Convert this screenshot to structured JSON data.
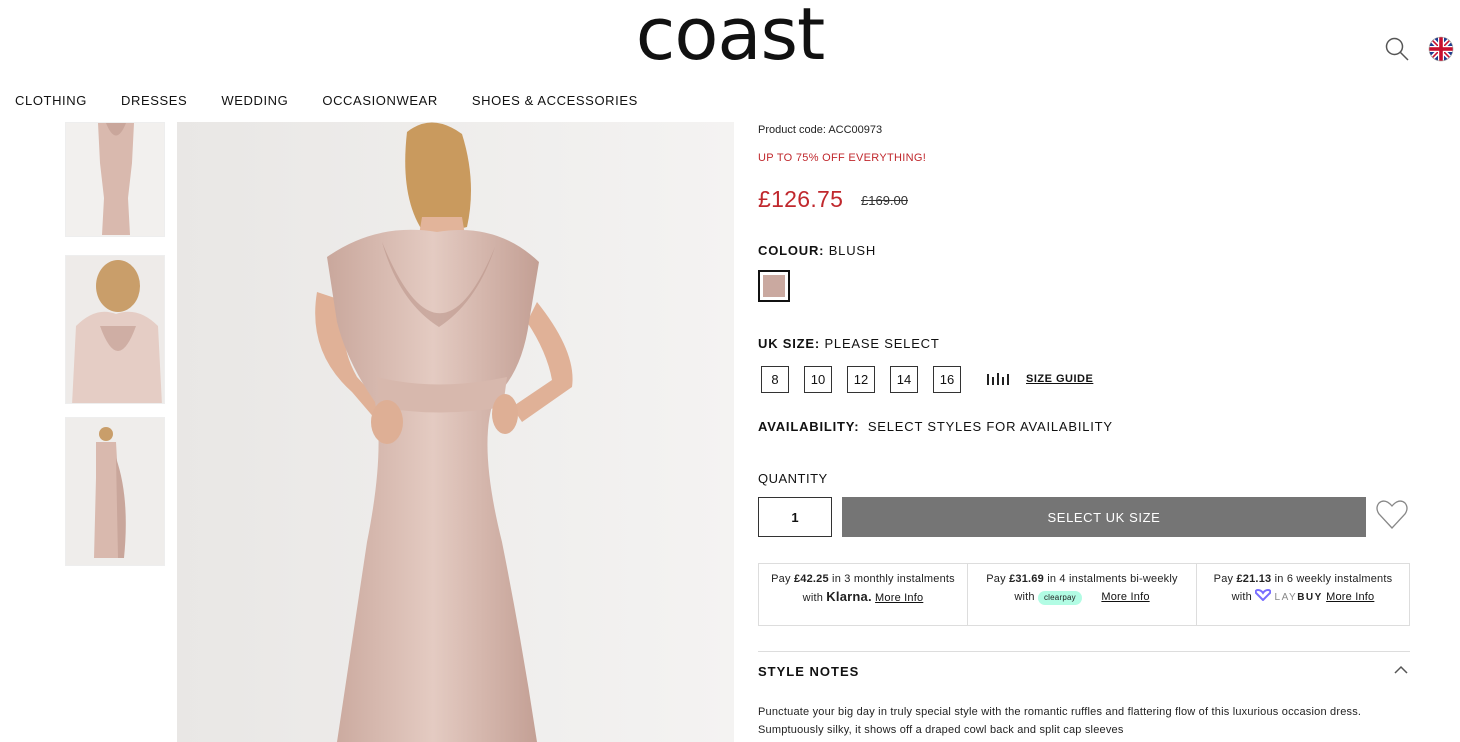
{
  "brand": {
    "logo_text": "coast"
  },
  "header": {
    "icons": [
      "search-icon",
      "uk-flag-icon"
    ]
  },
  "nav": {
    "items": [
      "CLOTHING",
      "DRESSES",
      "WEDDING",
      "OCCASIONWEAR",
      "SHOES & ACCESSORIES"
    ]
  },
  "product": {
    "code_text": "Product code: ACC00973",
    "promo": "UP TO 75% OFF EVERYTHING!",
    "price": "£126.75",
    "was_price": "£169.00",
    "colour_label": "COLOUR:",
    "colour_value": "BLUSH",
    "swatch_color": "#caa9a0",
    "size_label": "UK SIZE:",
    "size_value": "PLEASE SELECT",
    "sizes": [
      "8",
      "10",
      "12",
      "14",
      "16"
    ],
    "size_guide": "SIZE GUIDE",
    "availability_label": "AVAILABILITY:",
    "availability_value": "SELECT STYLES FOR AVAILABILITY",
    "quantity_label": "QUANTITY",
    "quantity": "1",
    "add_button": "SELECT UK SIZE"
  },
  "payments": {
    "klarna": {
      "pre": "Pay ",
      "amount": "£42.25",
      "mid": " in 3 monthly instalments with ",
      "brand": "Klarna.",
      "link": "More Info"
    },
    "clearpay": {
      "pre": "Pay ",
      "amount": "£31.69",
      "mid": " in 4 instalments bi-weekly with ",
      "brand": "clearpay",
      "link": "More Info"
    },
    "laybuy": {
      "pre": "Pay ",
      "amount": "£21.13",
      "mid": " in 6 weekly instalments with ",
      "brand_light": "LAY",
      "brand_bold": "BUY",
      "link": "More Info"
    }
  },
  "style_notes": {
    "title": "STYLE NOTES",
    "text": "Punctuate your big day in truly special style with the romantic ruffles and flattering flow of this luxurious occasion dress. Sumptuously silky, it shows off a draped cowl back and split cap sleeves"
  },
  "colors": {
    "sale_red": "#c0282d",
    "button_grey": "#757575",
    "clearpay_mint": "#b2fce4",
    "laybuy_purple": "#786dff"
  }
}
